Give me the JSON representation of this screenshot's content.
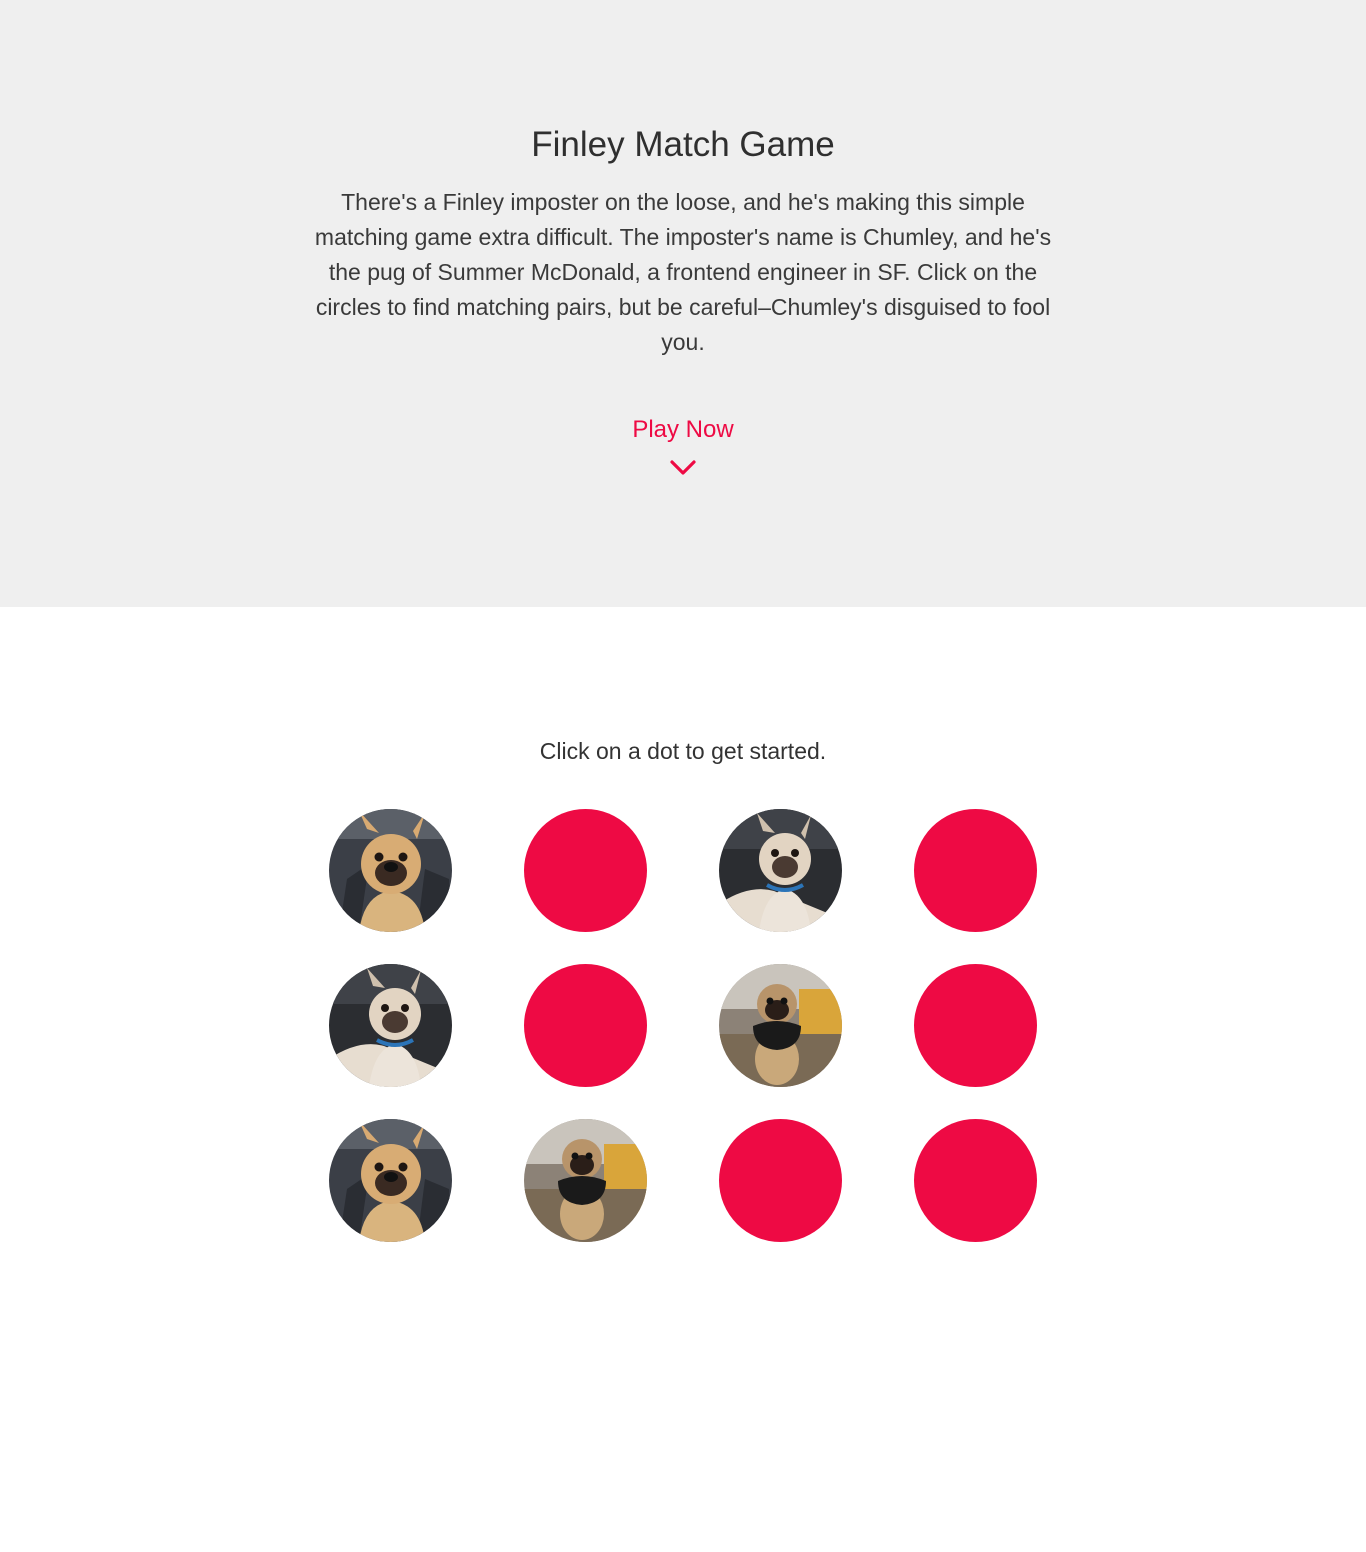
{
  "hero": {
    "title": "Finley Match Game",
    "description": "There's a Finley imposter on the loose, and he's making this simple matching game extra difficult. The imposter's name is Chumley, and he's the pug of Summer McDonald, a frontend engineer in SF. Click on the circles to find matching pairs, but be careful–Chumley's disguised to fool you.",
    "play_label": "Play Now",
    "play_icon": "chevron-down-icon"
  },
  "game": {
    "instructions": "Click on a dot to get started.",
    "dots": [
      {
        "state": "revealed",
        "image": "finley-closeup-photo"
      },
      {
        "state": "hidden"
      },
      {
        "state": "revealed",
        "image": "finley-lounging-photo"
      },
      {
        "state": "hidden"
      },
      {
        "state": "revealed",
        "image": "finley-lounging-photo"
      },
      {
        "state": "hidden"
      },
      {
        "state": "revealed",
        "image": "chumley-pug-photo"
      },
      {
        "state": "hidden"
      },
      {
        "state": "revealed",
        "image": "finley-closeup-photo"
      },
      {
        "state": "revealed",
        "image": "chumley-pug-photo"
      },
      {
        "state": "hidden"
      },
      {
        "state": "hidden"
      }
    ]
  },
  "colors": {
    "accent": "#ee0a44",
    "hero_background": "#efefef",
    "page_background": "#ffffff",
    "text": "#333333"
  }
}
